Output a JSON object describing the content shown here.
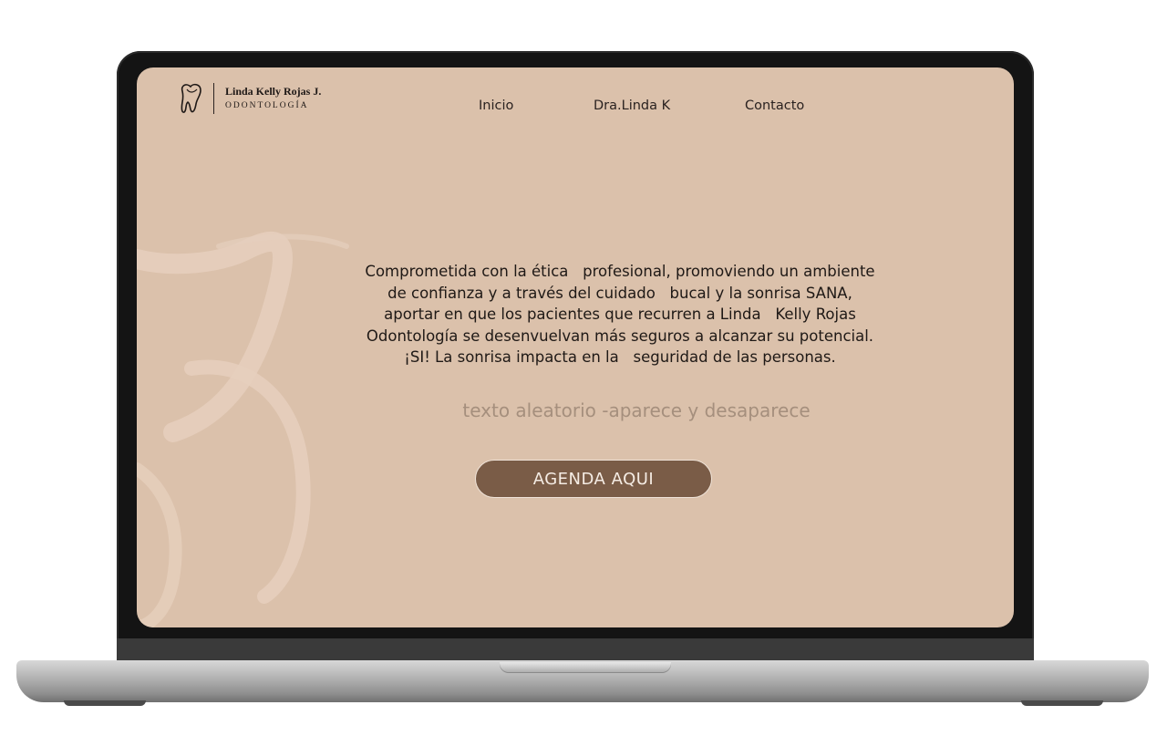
{
  "header": {
    "logo_name": "Linda Kelly Rojas J.",
    "logo_subtitle": "ODONTOLOGÍA",
    "logo_icon": "tooth-icon"
  },
  "nav": {
    "items": [
      {
        "label": "Inicio"
      },
      {
        "label": "Dra.Linda K"
      },
      {
        "label": "Contacto"
      }
    ]
  },
  "hero": {
    "lines": [
      "Comprometida con la ética   profesional, promoviendo un ambiente",
      "de confianza y a través del cuidado   bucal y la sonrisa SANA,",
      "aportar en que los pacientes que recurren a Linda   Kelly Rojas",
      "Odontología se desenvuelvan más seguros a alcanzar su potencial.",
      "¡SI! La sonrisa impacta en la   seguridad de las personas."
    ],
    "rotating_text": "texto aleatorio -aparece y desaparece",
    "cta_label": "AGENDA AQUI"
  },
  "colors": {
    "screen_background": "#dbc1ab",
    "cta_background": "#7a5c47",
    "rotating_text": "#a58f7d",
    "decoration": "#e6cfbd"
  }
}
